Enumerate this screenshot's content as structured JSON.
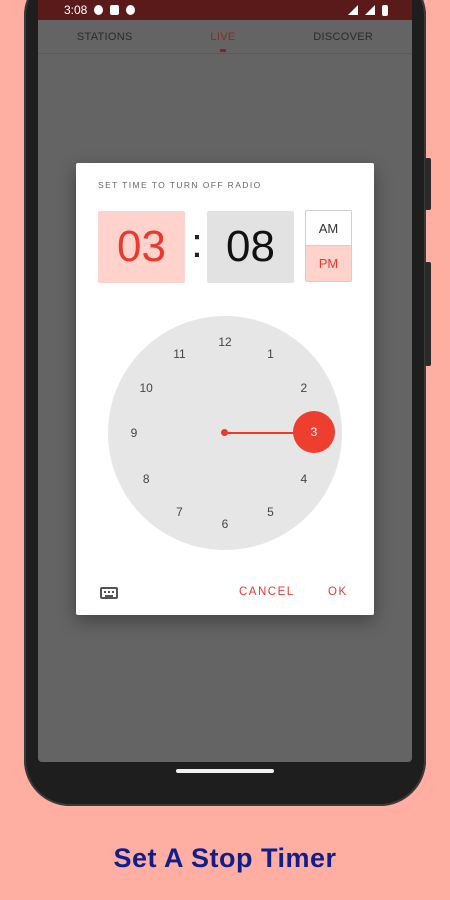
{
  "status_bar": {
    "time": "3:08"
  },
  "tabs": [
    {
      "label": "STATIONS"
    },
    {
      "label": "LIVE"
    },
    {
      "label": "DISCOVER"
    }
  ],
  "dialog": {
    "title": "SET TIME TO TURN OFF RADIO",
    "hour": "03",
    "separator": ":",
    "minute": "08",
    "am_label": "AM",
    "pm_label": "PM",
    "selected_period": "PM",
    "clock_numbers": [
      "12",
      "1",
      "2",
      "3",
      "4",
      "5",
      "6",
      "7",
      "8",
      "9",
      "10",
      "11"
    ],
    "selected_number": "3",
    "cancel_label": "CANCEL",
    "ok_label": "OK"
  },
  "caption": "Set A Stop Timer",
  "colors": {
    "accent": "#e83a2e",
    "accent_light": "#ffd2cc",
    "background": "#ffaea1",
    "caption": "#0e1f8a"
  }
}
